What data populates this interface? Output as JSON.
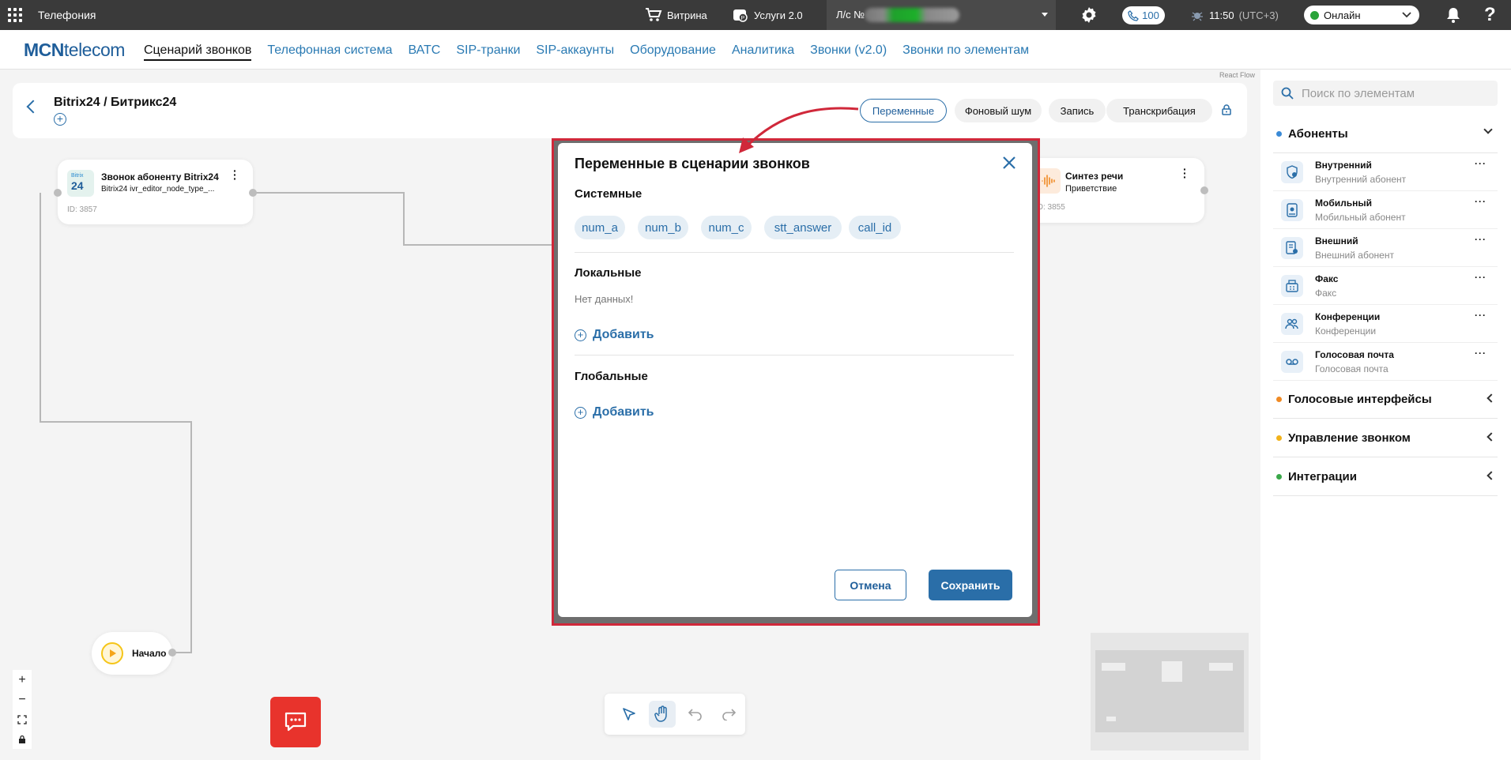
{
  "topbar": {
    "app_title": "Телефония",
    "showcase": "Витрина",
    "services": "Услуги 2.0",
    "account_label": "Л/с №",
    "calls_count": "100",
    "time": "11:50",
    "timezone": "(UTC+3)",
    "status": "Онлайн",
    "help": "?"
  },
  "nav": {
    "logo_bold": "MCN",
    "logo_rest": "telecom",
    "items": [
      "Сценарий звонков",
      "Телефонная система",
      "ВАТС",
      "SIP-транки",
      "SIP-аккаунты",
      "Оборудование",
      "Аналитика",
      "Звонки (v2.0)",
      "Звонки по элементам"
    ],
    "react_flow": "React Flow"
  },
  "header": {
    "title": "Bitrix24 / Битрикс24",
    "buttons": [
      "Переменные",
      "Фоновый шум",
      "Запись",
      "Транскрибация"
    ]
  },
  "canvas": {
    "node_bitrix": {
      "title": "Звонок абоненту Bitrix24",
      "subtitle": "Bitrix24 ivr_editor_node_type_...",
      "id": "ID: 3857",
      "logo_top": "Bitrix",
      "logo_num": "24"
    },
    "node_tts": {
      "title": "Синтез речи",
      "subtitle": "Приветствие",
      "id": "ID: 3855"
    },
    "node_start": {
      "label": "Начало"
    }
  },
  "dialog": {
    "title": "Переменные в сценарии звонков",
    "system_title": "Системные",
    "system_vars": [
      "num_a",
      "num_b",
      "num_c",
      "stt_answer",
      "call_id"
    ],
    "local_title": "Локальные",
    "no_data": "Нет данных!",
    "add_label": "Добавить",
    "global_title": "Глобальные",
    "cancel": "Отмена",
    "save": "Сохранить"
  },
  "sidebar": {
    "search_placeholder": "Поиск по элементам",
    "sections": [
      {
        "title": "Абоненты",
        "color": "#3a8ad6"
      },
      {
        "title": "Голосовые интерфейсы",
        "color": "#f08a24"
      },
      {
        "title": "Управление звонком",
        "color": "#f2b21a"
      },
      {
        "title": "Интеграции",
        "color": "#3aa84a"
      }
    ],
    "items": [
      {
        "title": "Внутренний",
        "sub": "Внутренний абонент"
      },
      {
        "title": "Мобильный",
        "sub": "Мобильный абонент"
      },
      {
        "title": "Внешний",
        "sub": "Внешний абонент"
      },
      {
        "title": "Факс",
        "sub": "Факс"
      },
      {
        "title": "Конференции",
        "sub": "Конференции"
      },
      {
        "title": "Голосовая почта",
        "sub": "Голосовая почта"
      }
    ],
    "more": "···"
  },
  "controls": {
    "zoom_in": "+",
    "zoom_out": "−"
  }
}
